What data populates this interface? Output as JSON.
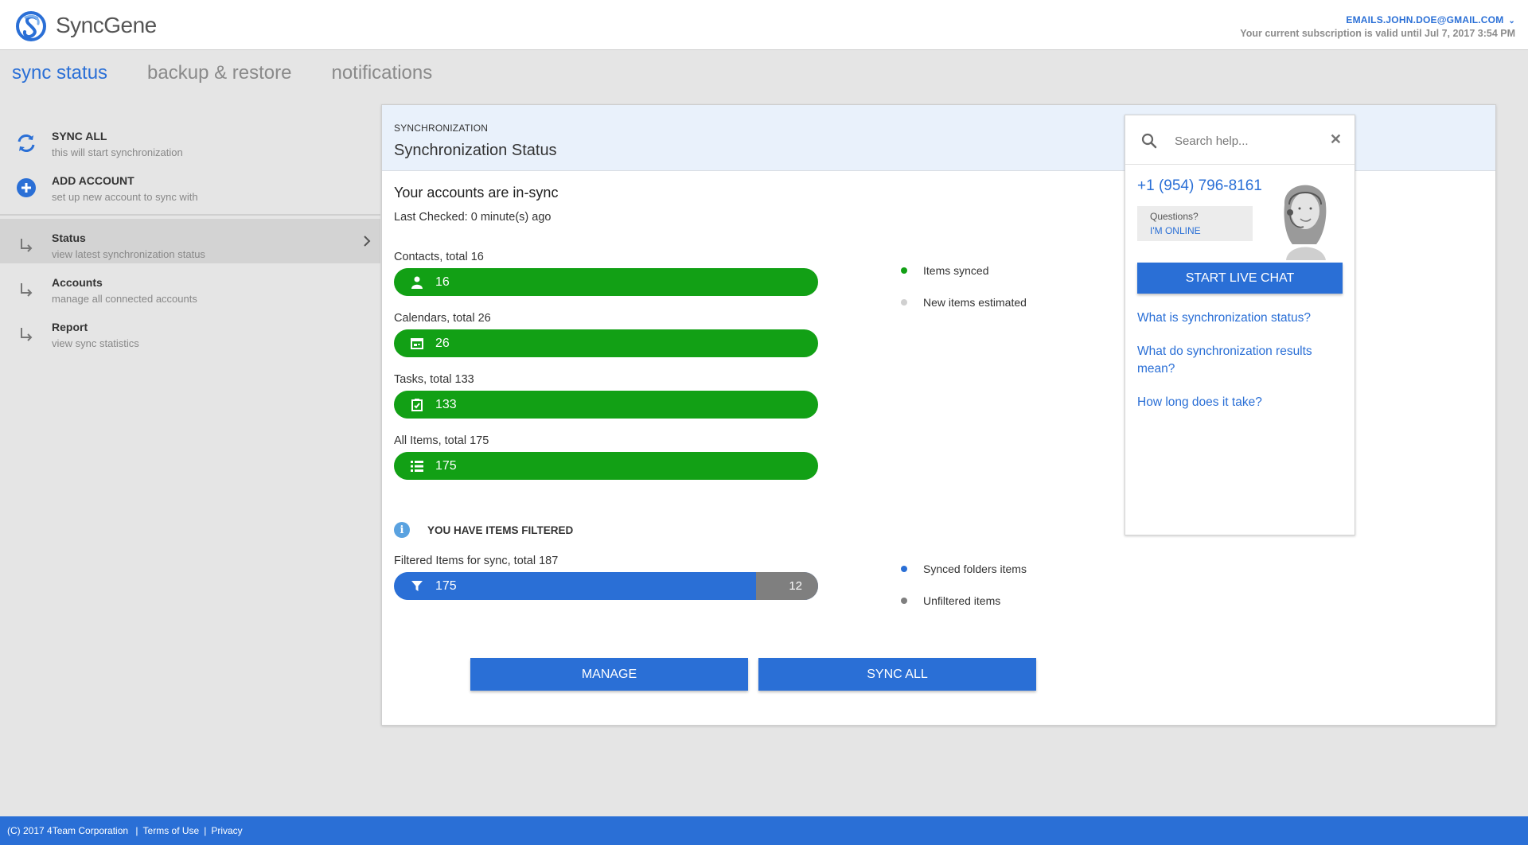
{
  "app": {
    "name_sync": "Sync",
    "name_gene": "Gene"
  },
  "account": {
    "email": "EMAILS.JOHN.DOE@GMAIL.COM",
    "subscription": "Your current subscription is valid until Jul 7, 2017 3:54 PM"
  },
  "tabs": [
    {
      "label": "sync status",
      "active": true
    },
    {
      "label": "backup & restore",
      "active": false
    },
    {
      "label": "notifications",
      "active": false
    }
  ],
  "sidebar": {
    "actions": [
      {
        "title": "SYNC ALL",
        "desc": "this will start synchronization",
        "icon": "sync-icon"
      },
      {
        "title": "ADD ACCOUNT",
        "desc": "set up new account to sync with",
        "icon": "add-circle-icon"
      }
    ],
    "items": [
      {
        "title": "Status",
        "desc": "view latest synchronization status",
        "selected": true
      },
      {
        "title": "Accounts",
        "desc": "manage all connected accounts",
        "selected": false
      },
      {
        "title": "Report",
        "desc": "view sync statistics",
        "selected": false
      }
    ]
  },
  "panel": {
    "kicker": "SYNCHRONIZATION",
    "title": "Synchronization Status",
    "status": "Your accounts are in-sync",
    "last_checked": "Last Checked: 0 minute(s) ago",
    "bars": [
      {
        "label": "Contacts, total 16",
        "value": "16",
        "icon": "person-icon"
      },
      {
        "label": "Calendars, total 26",
        "value": "26",
        "icon": "calendar-icon"
      },
      {
        "label": "Tasks, total 133",
        "value": "133",
        "icon": "task-icon"
      },
      {
        "label": "All Items, total 175",
        "value": "175",
        "icon": "list-icon"
      }
    ],
    "legend_top": [
      {
        "label": "Items synced",
        "color": "#12a015"
      },
      {
        "label": "New items estimated",
        "color": "#cccccc"
      }
    ],
    "filtered_note": "YOU HAVE ITEMS FILTERED",
    "filtered_bar": {
      "label": "Filtered Items for sync, total 187",
      "synced": "175",
      "unfiltered": "12",
      "synced_fraction": 0.936
    },
    "legend_bottom": [
      {
        "label": "Synced folders items",
        "color": "#2a6fd6"
      },
      {
        "label": "Unfiltered items",
        "color": "#7f7f7f"
      }
    ],
    "buttons": {
      "manage": "MANAGE",
      "sync_all": "SYNC ALL"
    }
  },
  "help": {
    "search_placeholder": "Search help...",
    "phone": "+1 (954) 796-8161",
    "questions": "Questions?",
    "online": "I'M ONLINE",
    "chat_button": "START LIVE CHAT",
    "links": [
      "What is synchronization status?",
      "What do synchronization results mean?",
      "How long does it take?"
    ]
  },
  "footer": {
    "copyright": "(C) 2017  4Team Corporation",
    "terms": "Terms of Use",
    "privacy": "Privacy"
  },
  "colors": {
    "accent": "#2a6fd6",
    "success": "#12a015",
    "muted": "#7f7f7f"
  }
}
